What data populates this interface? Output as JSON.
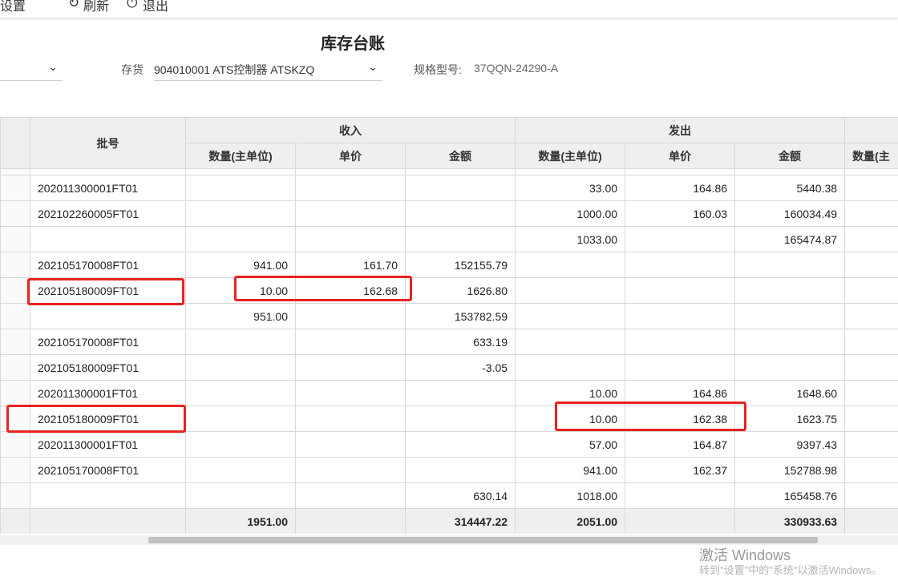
{
  "toolbar": {
    "frag1": "设置",
    "frag2": "刷新",
    "frag3": "退出",
    "refresh_icon": "refresh-icon",
    "exit_icon": "exit-icon"
  },
  "page_title": "库存台账",
  "filters": {
    "left_select_value": "",
    "stock_label": "存货",
    "stock_value": "904010001 ATS控制器 ATSKZQ",
    "spec_label": "规格型号:",
    "spec_value": "37QQN-24290-A"
  },
  "table": {
    "batch_header": "批号",
    "receipt_group": "收入",
    "issue_group": "发出",
    "receipt_qty_header": "数量(主单位)",
    "receipt_price_header": "单价",
    "receipt_amount_header": "金额",
    "issue_qty_header": "数量(主单位)",
    "issue_price_header": "单价",
    "issue_amount_header": "金额",
    "balance_qty_header": "数量(主",
    "rows": [
      {
        "batch": "202011300001FT01",
        "r_qty": "",
        "r_price": "",
        "r_amt": "",
        "i_qty": "33.00",
        "i_price": "164.86",
        "i_amt": "5440.38"
      },
      {
        "batch": "202102260005FT01",
        "r_qty": "",
        "r_price": "",
        "r_amt": "",
        "i_qty": "1000.00",
        "i_price": "160.03",
        "i_amt": "160034.49"
      },
      {
        "batch": "",
        "r_qty": "",
        "r_price": "",
        "r_amt": "",
        "i_qty": "1033.00",
        "i_price": "",
        "i_amt": "165474.87"
      },
      {
        "batch": "202105170008FT01",
        "r_qty": "941.00",
        "r_price": "161.70",
        "r_amt": "152155.79",
        "i_qty": "",
        "i_price": "",
        "i_amt": ""
      },
      {
        "batch": "202105180009FT01",
        "r_qty": "10.00",
        "r_price": "162.68",
        "r_amt": "1626.80",
        "i_qty": "",
        "i_price": "",
        "i_amt": ""
      },
      {
        "batch": "",
        "r_qty": "951.00",
        "r_price": "",
        "r_amt": "153782.59",
        "i_qty": "",
        "i_price": "",
        "i_amt": ""
      },
      {
        "batch": "202105170008FT01",
        "r_qty": "",
        "r_price": "",
        "r_amt": "633.19",
        "i_qty": "",
        "i_price": "",
        "i_amt": ""
      },
      {
        "batch": "202105180009FT01",
        "r_qty": "",
        "r_price": "",
        "r_amt": "-3.05",
        "i_qty": "",
        "i_price": "",
        "i_amt": ""
      },
      {
        "batch": "202011300001FT01",
        "r_qty": "",
        "r_price": "",
        "r_amt": "",
        "i_qty": "10.00",
        "i_price": "164.86",
        "i_amt": "1648.60"
      },
      {
        "batch": "202105180009FT01",
        "r_qty": "",
        "r_price": "",
        "r_amt": "",
        "i_qty": "10.00",
        "i_price": "162.38",
        "i_amt": "1623.75"
      },
      {
        "batch": "202011300001FT01",
        "r_qty": "",
        "r_price": "",
        "r_amt": "",
        "i_qty": "57.00",
        "i_price": "164.87",
        "i_amt": "9397.43"
      },
      {
        "batch": "202105170008FT01",
        "r_qty": "",
        "r_price": "",
        "r_amt": "",
        "i_qty": "941.00",
        "i_price": "162.37",
        "i_amt": "152788.98"
      },
      {
        "batch": "",
        "r_qty": "",
        "r_price": "",
        "r_amt": "630.14",
        "i_qty": "1018.00",
        "i_price": "",
        "i_amt": "165458.76"
      }
    ],
    "total": {
      "batch": "",
      "r_qty": "1951.00",
      "r_price": "",
      "r_amt": "314447.22",
      "i_qty": "2051.00",
      "i_price": "",
      "i_amt": "330933.63"
    }
  },
  "watermark": {
    "line1": "激活 Windows",
    "line2": "转到\"设置\"中的\"系统\"以激活Windows。"
  },
  "colors": {
    "highlight": "#e8231f",
    "negative": "#e02020",
    "header_bg": "#efefef"
  }
}
